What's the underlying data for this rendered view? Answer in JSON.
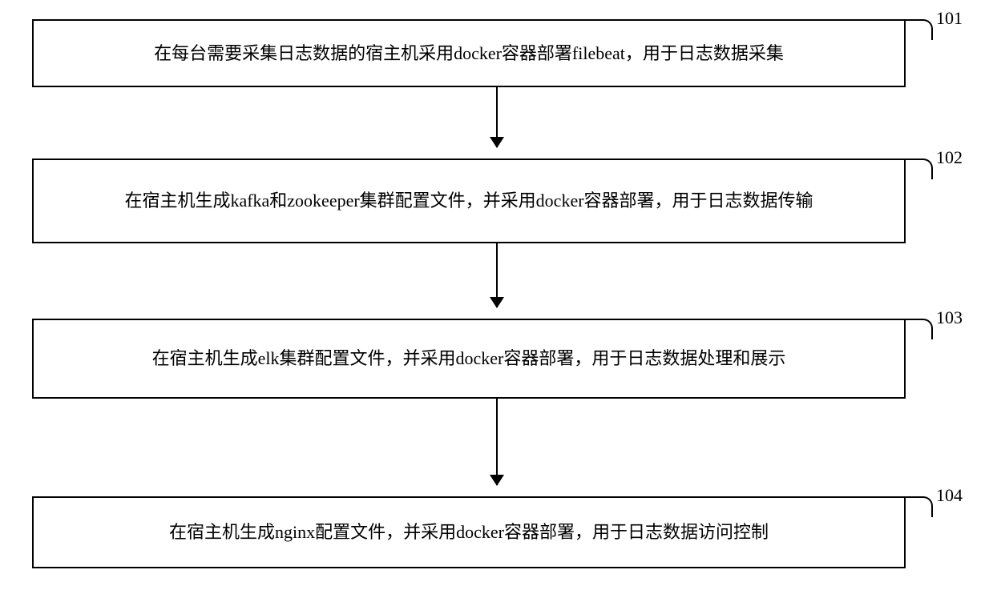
{
  "steps": [
    {
      "label": "101",
      "text": "在每台需要采集日志数据的宿主机采用docker容器部署filebeat，用于日志数据采集"
    },
    {
      "label": "102",
      "text": "在宿主机生成kafka和zookeeper集群配置文件，并采用docker容器部署，用于日志数据传输"
    },
    {
      "label": "103",
      "text": "在宿主机生成elk集群配置文件，并采用docker容器部署，用于日志数据处理和展示"
    },
    {
      "label": "104",
      "text": "在宿主机生成nginx配置文件，并采用docker容器部署，用于日志数据访问控制"
    }
  ]
}
